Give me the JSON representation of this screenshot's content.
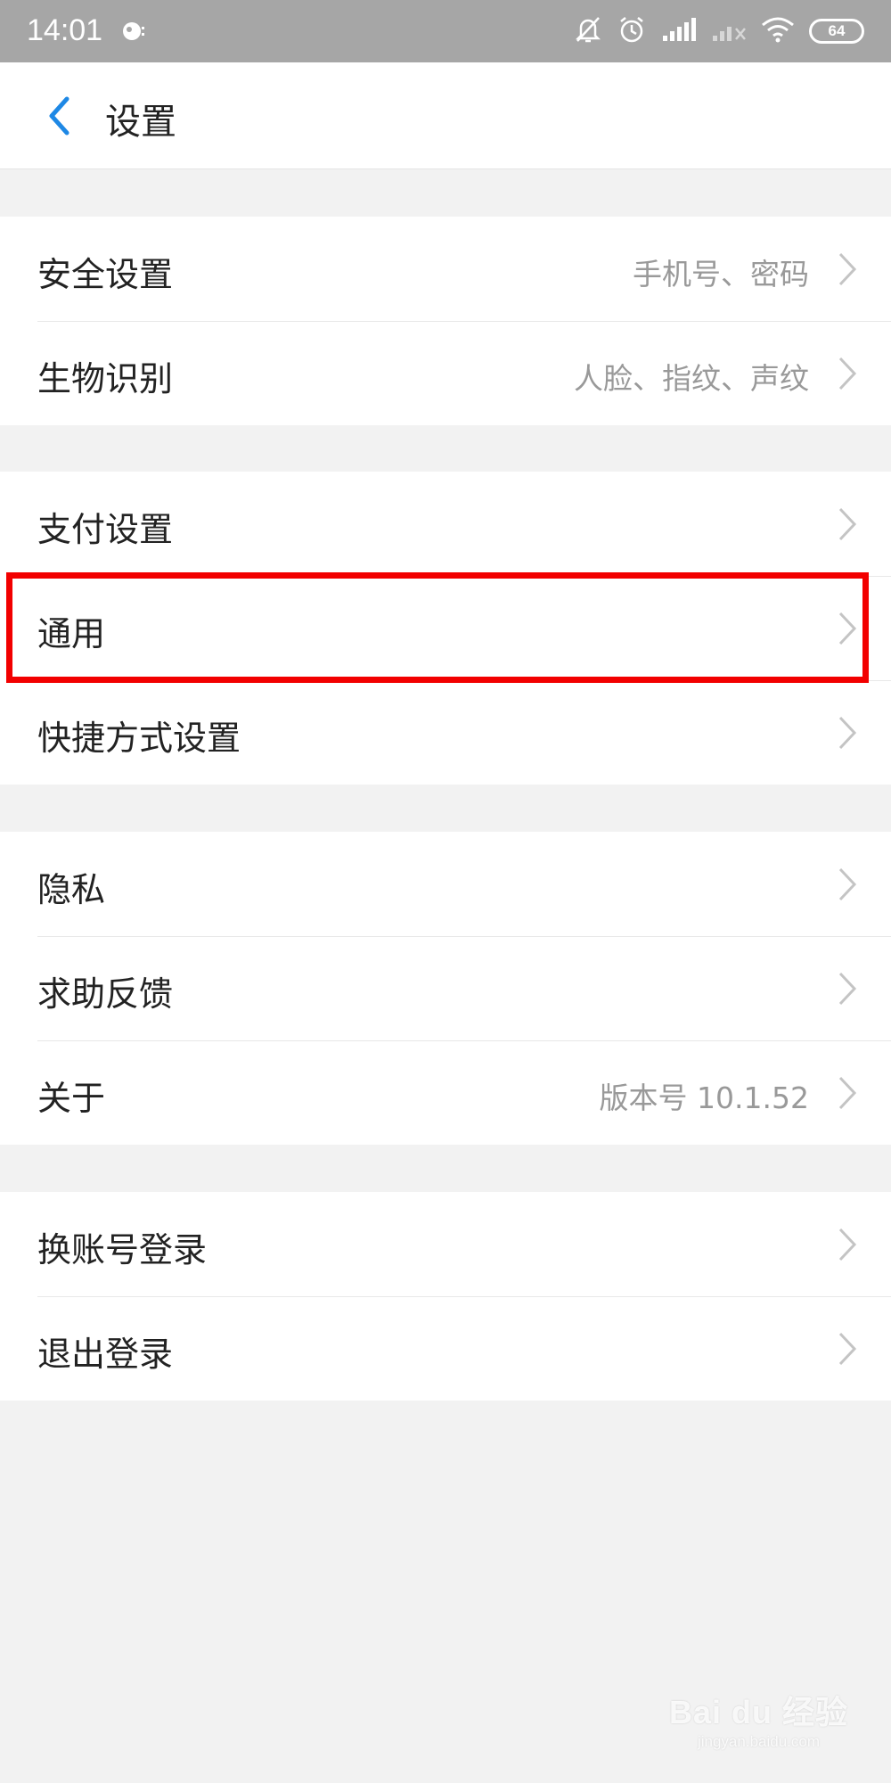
{
  "status_bar": {
    "time": "14:01",
    "battery": "64",
    "icons": [
      "notification-icon",
      "bell-mute-icon",
      "alarm-icon",
      "signal-icon",
      "signal-no-sim-icon",
      "wifi-icon",
      "battery-icon"
    ]
  },
  "header": {
    "title": "设置",
    "back_icon": "chevron-left-icon",
    "accent_color": "#1e88e5"
  },
  "groups": [
    {
      "items": [
        {
          "label": "安全设置",
          "value": "手机号、密码"
        },
        {
          "label": "生物识别",
          "value": "人脸、指纹、声纹"
        }
      ]
    },
    {
      "items": [
        {
          "label": "支付设置",
          "value": ""
        },
        {
          "label": "通用",
          "value": "",
          "highlighted": true
        },
        {
          "label": "快捷方式设置",
          "value": ""
        }
      ]
    },
    {
      "items": [
        {
          "label": "隐私",
          "value": ""
        },
        {
          "label": "求助反馈",
          "value": ""
        },
        {
          "label": "关于",
          "value": "版本号 10.1.52"
        }
      ]
    },
    {
      "items": [
        {
          "label": "换账号登录",
          "value": ""
        },
        {
          "label": "退出登录",
          "value": ""
        }
      ]
    }
  ],
  "highlight_color": "#f20000",
  "watermark": {
    "main": "Bai du 经验",
    "sub": "jingyan.baidu.com"
  }
}
